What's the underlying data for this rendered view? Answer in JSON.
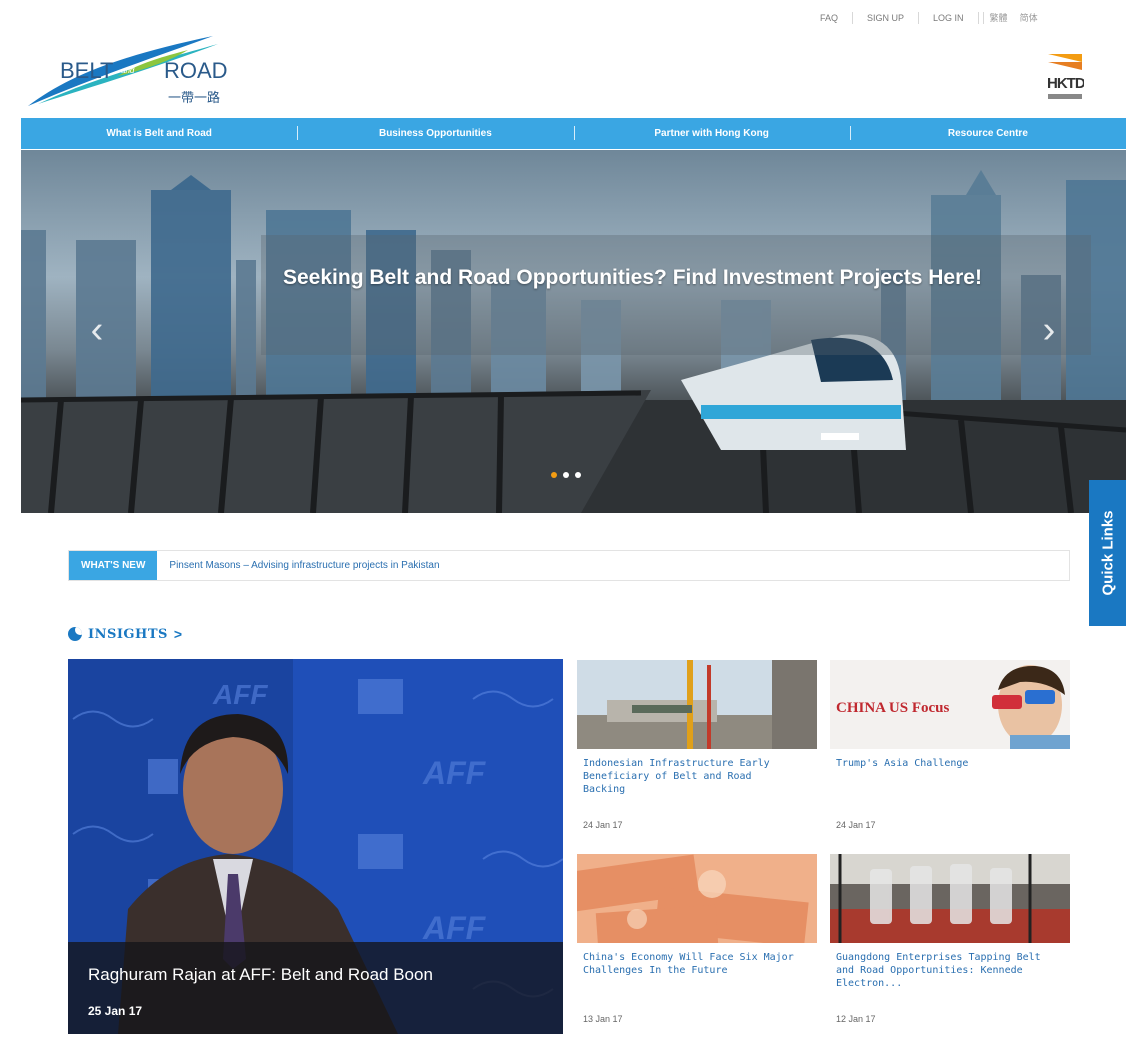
{
  "util": {
    "faq": "FAQ",
    "signup": "SIGN UP",
    "login": "LOG IN",
    "lang_tc": "繁體",
    "lang_sc": "简体"
  },
  "logo": {
    "text_belt": "BELT",
    "text_and": "and",
    "text_road": "ROAD",
    "text_cn": "一帶一路",
    "hktdc": "HKTDC"
  },
  "nav": {
    "items": [
      {
        "label": "What is Belt and Road"
      },
      {
        "label": "Business Opportunities"
      },
      {
        "label": "Partner with Hong Kong"
      },
      {
        "label": "Resource Centre"
      }
    ]
  },
  "hero": {
    "title": "Seeking Belt and Road Opportunities? Find Investment Projects Here!",
    "prev_icon": "chevron-left-icon",
    "next_icon": "chevron-right-icon",
    "slides": 3,
    "active_slide": 1
  },
  "quick_links": {
    "label": "Quick Links"
  },
  "whats_new": {
    "tag": "WHAT'S NEW",
    "text": "Pinsent Masons – Advising infrastructure projects in Pakistan"
  },
  "insights": {
    "heading": "INSIGHTS",
    "chevron": ">",
    "feature": {
      "title": "Raghuram Rajan at AFF: Belt and Road Boon",
      "date": "25 Jan 17"
    },
    "cards": [
      {
        "title": "Indonesian Infrastructure Early Beneficiary of Belt and Road Backing",
        "date": "24 Jan 17"
      },
      {
        "title": "Trump's Asia Challenge",
        "date": "24 Jan 17",
        "thumb_text": "CHINA US Focus"
      },
      {
        "title": "China's Economy Will Face Six Major Challenges In the Future",
        "date": "13 Jan 17"
      },
      {
        "title": "Guangdong Enterprises Tapping Belt and Road Opportunities: Kennede Electron...",
        "date": "12 Jan 17"
      }
    ]
  },
  "colors": {
    "nav_blue": "#3aa6e3",
    "brand_blue": "#1a78c2",
    "link_blue": "#2a6fb0",
    "active_dot": "#f39c12"
  }
}
